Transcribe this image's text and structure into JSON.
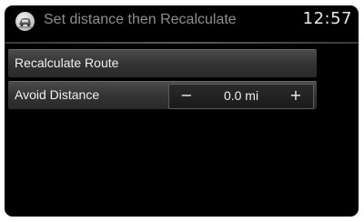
{
  "header": {
    "icon": "route-car-icon",
    "title": "Set distance then Recalculate",
    "clock": "12:57"
  },
  "menu": {
    "recalculate_label": "Recalculate Route",
    "avoid_label": "Avoid Distance",
    "avoid_value": "0.0 mi",
    "minus_label": "−",
    "plus_label": "+"
  },
  "colors": {
    "background": "#000000",
    "row": "#3a3a3a",
    "text": "#f0f0f0",
    "title": "#8e8e8e"
  }
}
